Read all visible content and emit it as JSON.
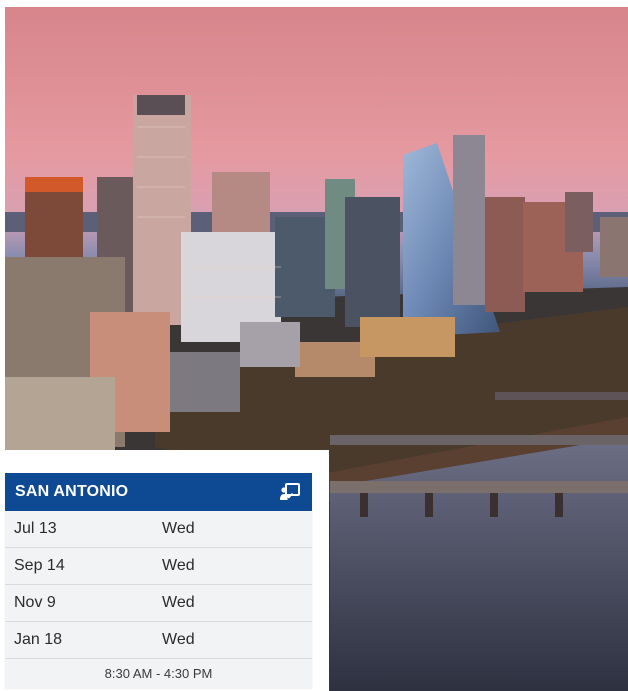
{
  "image": {
    "alt_icon": "city-skyline-photo"
  },
  "schedule": {
    "city": "SAN ANTONIO",
    "header_icon": "presentation-icon",
    "rows": [
      {
        "date": "Jul 13",
        "day": "Wed"
      },
      {
        "date": "Sep 14",
        "day": "Wed"
      },
      {
        "date": "Nov 9",
        "day": "Wed"
      },
      {
        "date": "Jan 18",
        "day": "Wed"
      }
    ],
    "time": "8:30 AM - 4:30 PM"
  },
  "colors": {
    "header_bg": "#0d4a93",
    "card_bg": "#f2f3f5"
  }
}
